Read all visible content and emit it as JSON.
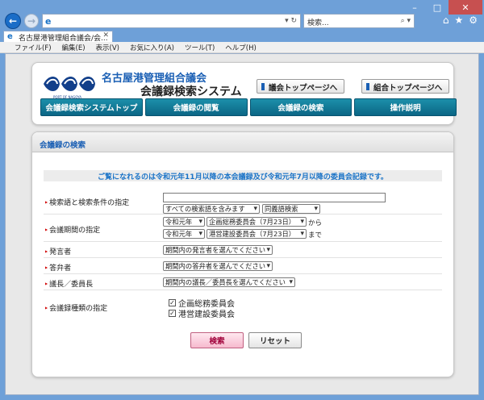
{
  "browser": {
    "address_value": "",
    "search_placeholder": "検索...",
    "tab_title": "名古屋港管理組合議会/会...",
    "menu": [
      "ファイル(F)",
      "編集(E)",
      "表示(V)",
      "お気に入り(A)",
      "ツール(T)",
      "ヘルプ(H)"
    ]
  },
  "site": {
    "title_line1": "名古屋港管理組合議会",
    "title_line2": "会議録検索システム",
    "top_buttons": [
      "議会トップページへ",
      "組合トップページへ"
    ],
    "nav": [
      "会議録検索システムトップ",
      "会議録の閲覧",
      "会議録の検索",
      "操作説明"
    ]
  },
  "panel": {
    "heading": "会議録の検索",
    "notice": "ご覧になれるのは令和元年11月以降の本会議録及び令和元年7月以降の委員会記録です。",
    "fields": {
      "keyword": {
        "label": "検索語と検索条件の指定",
        "value": "",
        "condition": "すべての検索語を含みます",
        "match": "同義語検索"
      },
      "period": {
        "label": "会議期間の指定",
        "from_era": "令和元年",
        "from_meeting": "企画総務委員会（7月23日）",
        "from_suffix": "から",
        "to_era": "令和元年",
        "to_meeting": "港営建設委員会（7月23日）",
        "to_suffix": "まで"
      },
      "speaker": {
        "label": "発言者",
        "value": "期間内の発言者を選んでください"
      },
      "answerer": {
        "label": "答弁者",
        "value": "期間内の答弁者を選んでください"
      },
      "chair": {
        "label": "議長／委員長",
        "value": "期間内の議長／委員長を選んでください"
      },
      "types": {
        "label": "会議録種類の指定",
        "options": [
          {
            "label": "企画総務委員会",
            "checked": true
          },
          {
            "label": "港営建設委員会",
            "checked": true
          }
        ]
      }
    },
    "search_button": "検索",
    "reset_button": "リセット"
  }
}
